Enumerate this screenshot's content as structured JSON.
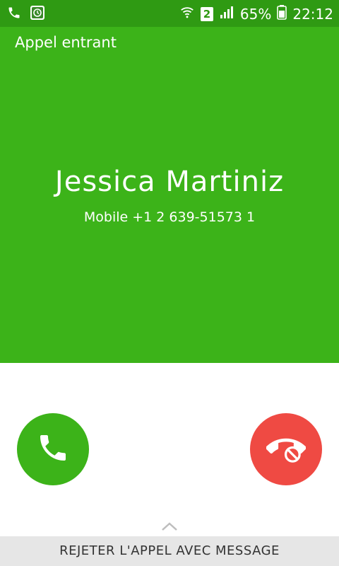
{
  "status_bar": {
    "battery": "65%",
    "time": "22:12",
    "sim_slot": "2",
    "icons": [
      "phone-icon",
      "notification-app-icon",
      "wifi-icon",
      "sim-icon",
      "signal-icon",
      "battery-icon"
    ]
  },
  "incoming": {
    "status": "Appel entrant",
    "caller_name": "Jessica Martiniz",
    "caller_number": "Mobile +1 2 639-51573 1"
  },
  "actions": {
    "answer_icon": "phone-answer-icon",
    "reject_icon": "phone-reject-icon",
    "reject_with_message_label": "REJETER L'APPEL AVEC MESSAGE"
  },
  "colors": {
    "status_bar": "#2f9a13",
    "incoming_bg": "#3cb319",
    "answer": "#3cb319",
    "reject": "#ef4a43"
  }
}
